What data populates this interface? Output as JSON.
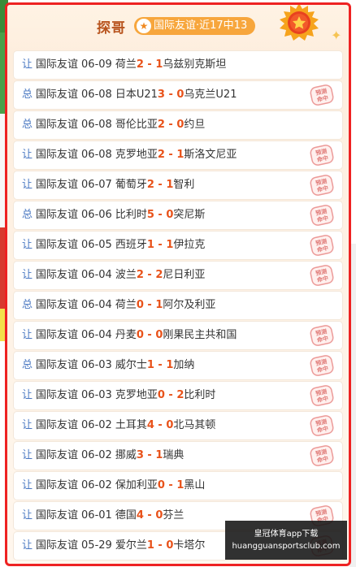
{
  "header": {
    "title": "探哥",
    "badge": "国际友谊·近17中13",
    "star_glyph": "★",
    "sparkle_glyph": "✦"
  },
  "stamp_text": [
    "预测",
    "命中"
  ],
  "colors": {
    "border": "#ee2222",
    "score": "#e8521a",
    "tag": "#4a78c2",
    "title": "#b8541e",
    "pill": "#f7a63c"
  },
  "rows": [
    {
      "tag": "让",
      "league": "国际友谊",
      "date": "06-09",
      "home": "荷兰",
      "hs": "2",
      "sep": " - ",
      "as": "1",
      "away": "乌兹别克斯坦",
      "hit": false
    },
    {
      "tag": "总",
      "league": "国际友谊",
      "date": "06-08",
      "home": "日本U21",
      "hs": "3",
      "sep": " - ",
      "as": "0",
      "away": "乌克兰U21",
      "hit": true
    },
    {
      "tag": "总",
      "league": "国际友谊",
      "date": "06-08",
      "home": "哥伦比亚",
      "hs": "2",
      "sep": " - ",
      "as": "0",
      "away": "约旦",
      "hit": false
    },
    {
      "tag": "让",
      "league": "国际友谊",
      "date": "06-08",
      "home": "克罗地亚",
      "hs": "2",
      "sep": " - ",
      "as": "1",
      "away": "斯洛文尼亚",
      "hit": true
    },
    {
      "tag": "让",
      "league": "国际友谊",
      "date": "06-07",
      "home": "葡萄牙",
      "hs": "2",
      "sep": " - ",
      "as": "1",
      "away": "智利",
      "hit": true
    },
    {
      "tag": "总",
      "league": "国际友谊",
      "date": "06-06",
      "home": "比利时",
      "hs": "5",
      "sep": " - ",
      "as": "0",
      "away": "突尼斯",
      "hit": true
    },
    {
      "tag": "让",
      "league": "国际友谊",
      "date": "06-05",
      "home": "西班牙",
      "hs": "1",
      "sep": " - ",
      "as": "1",
      "away": "伊拉克",
      "hit": true
    },
    {
      "tag": "让",
      "league": "国际友谊",
      "date": "06-04",
      "home": "波兰",
      "hs": "2",
      "sep": " - ",
      "as": "2",
      "away": "尼日利亚",
      "hit": true
    },
    {
      "tag": "总",
      "league": "国际友谊",
      "date": "06-04",
      "home": "荷兰",
      "hs": "0",
      "sep": " - ",
      "as": "1",
      "away": "阿尔及利亚",
      "hit": false
    },
    {
      "tag": "让",
      "league": "国际友谊",
      "date": "06-04",
      "home": "丹麦",
      "hs": "0",
      "sep": " - ",
      "as": "0",
      "away": "刚果民主共和国",
      "hit": true
    },
    {
      "tag": "总",
      "league": "国际友谊",
      "date": "06-03",
      "home": "威尔士",
      "hs": "1",
      "sep": " - ",
      "as": "1",
      "away": "加纳",
      "hit": true
    },
    {
      "tag": "让",
      "league": "国际友谊",
      "date": "06-03",
      "home": "克罗地亚",
      "hs": "0",
      "sep": " - ",
      "as": "2",
      "away": "比利时",
      "hit": true
    },
    {
      "tag": "让",
      "league": "国际友谊",
      "date": "06-02",
      "home": "土耳其",
      "hs": "4",
      "sep": " - ",
      "as": "0",
      "away": "北马其顿",
      "hit": true
    },
    {
      "tag": "让",
      "league": "国际友谊",
      "date": "06-02",
      "home": "挪威",
      "hs": "3",
      "sep": " - ",
      "as": "1",
      "away": "瑞典",
      "hit": true
    },
    {
      "tag": "让",
      "league": "国际友谊",
      "date": "06-02",
      "home": "保加利亚",
      "hs": "0",
      "sep": " - ",
      "as": "1",
      "away": "黑山",
      "hit": false
    },
    {
      "tag": "让",
      "league": "国际友谊",
      "date": "06-01",
      "home": "德国",
      "hs": "4",
      "sep": " - ",
      "as": "0",
      "away": "芬兰",
      "hit": true
    },
    {
      "tag": "让",
      "league": "国际友谊",
      "date": "05-29",
      "home": "爱尔兰",
      "hs": "1",
      "sep": " - ",
      "as": "0",
      "away": "卡塔尔",
      "hit": true
    }
  ],
  "watermark": {
    "line1": "皇冠体育app下载",
    "line2": "huangguansportsclub.com"
  }
}
